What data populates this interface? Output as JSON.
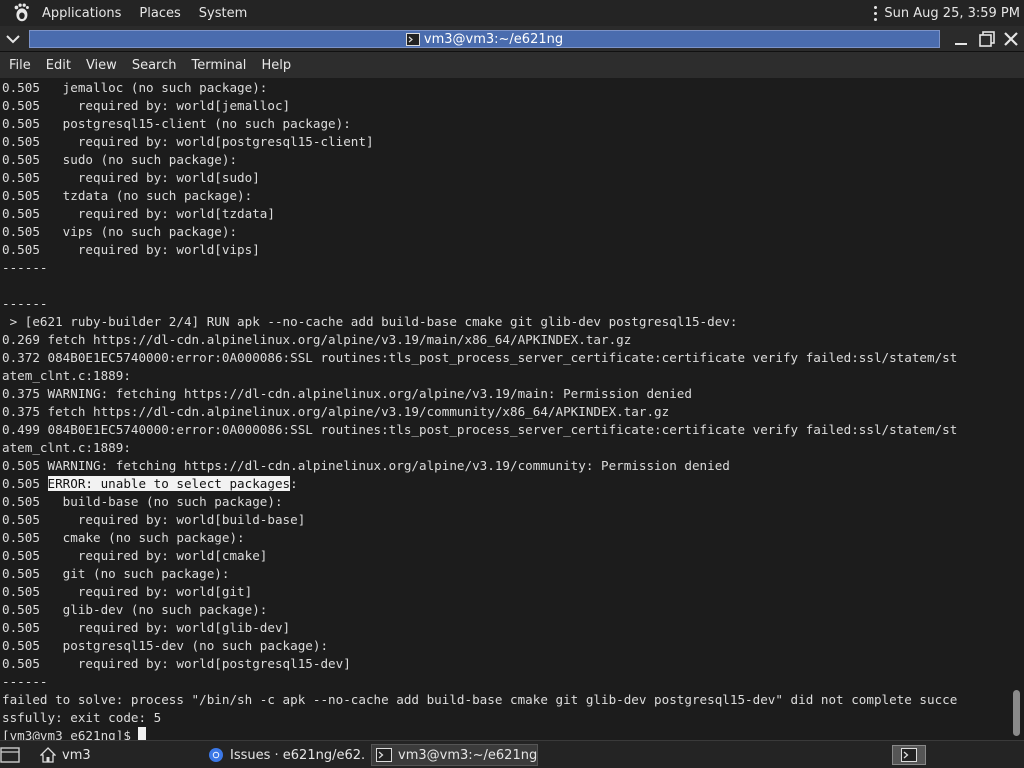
{
  "top_panel": {
    "menus": [
      "Applications",
      "Places",
      "System"
    ],
    "clock": "Sun Aug 25,  3:59 PM"
  },
  "window": {
    "title": "vm3@vm3:~/e621ng"
  },
  "menubar": [
    "File",
    "Edit",
    "View",
    "Search",
    "Terminal",
    "Help"
  ],
  "terminal": {
    "lines": [
      "0.505   jemalloc (no such package):",
      "0.505     required by: world[jemalloc]",
      "0.505   postgresql15-client (no such package):",
      "0.505     required by: world[postgresql15-client]",
      "0.505   sudo (no such package):",
      "0.505     required by: world[sudo]",
      "0.505   tzdata (no such package):",
      "0.505     required by: world[tzdata]",
      "0.505   vips (no such package):",
      "0.505     required by: world[vips]",
      "------",
      "",
      "------",
      " > [e621 ruby-builder 2/4] RUN apk --no-cache add build-base cmake git glib-dev postgresql15-dev:",
      "0.269 fetch https://dl-cdn.alpinelinux.org/alpine/v3.19/main/x86_64/APKINDEX.tar.gz",
      "0.372 084B0E1EC5740000:error:0A000086:SSL routines:tls_post_process_server_certificate:certificate verify failed:ssl/statem/st",
      "atem_clnt.c:1889:",
      "0.375 WARNING: fetching https://dl-cdn.alpinelinux.org/alpine/v3.19/main: Permission denied",
      "0.375 fetch https://dl-cdn.alpinelinux.org/alpine/v3.19/community/x86_64/APKINDEX.tar.gz",
      "0.499 084B0E1EC5740000:error:0A000086:SSL routines:tls_post_process_server_certificate:certificate verify failed:ssl/statem/st",
      "atem_clnt.c:1889:",
      "0.505 WARNING: fetching https://dl-cdn.alpinelinux.org/alpine/v3.19/community: Permission denied",
      "HL",
      "0.505   build-base (no such package):",
      "0.505     required by: world[build-base]",
      "0.505   cmake (no such package):",
      "0.505     required by: world[cmake]",
      "0.505   git (no such package):",
      "0.505     required by: world[git]",
      "0.505   glib-dev (no such package):",
      "0.505     required by: world[glib-dev]",
      "0.505   postgresql15-dev (no such package):",
      "0.505     required by: world[postgresql15-dev]",
      "------",
      "failed to solve: process \"/bin/sh -c apk --no-cache add build-base cmake git glib-dev postgresql15-dev\" did not complete succe",
      "ssfully: exit code: 5",
      "PROMPT"
    ],
    "highlight_line": {
      "prefix": "0.505 ",
      "selected": "ERROR: unable to select packages",
      "suffix": ":"
    },
    "prompt": "[vm3@vm3 e621ng]$ "
  },
  "taskbar": {
    "items": [
      {
        "label": "vm3",
        "icon": "home-folder-icon"
      },
      {
        "label": "Issues · e621ng/e62...",
        "icon": "chrome-icon"
      },
      {
        "label": "vm3@vm3:~/e621ng",
        "icon": "terminal-icon"
      }
    ]
  },
  "colors": {
    "title_strip": "#4a6cae",
    "terminal_bg": "#1c1c1c",
    "terminal_fg": "#dcdcdc",
    "panel_bg": "#242424"
  }
}
